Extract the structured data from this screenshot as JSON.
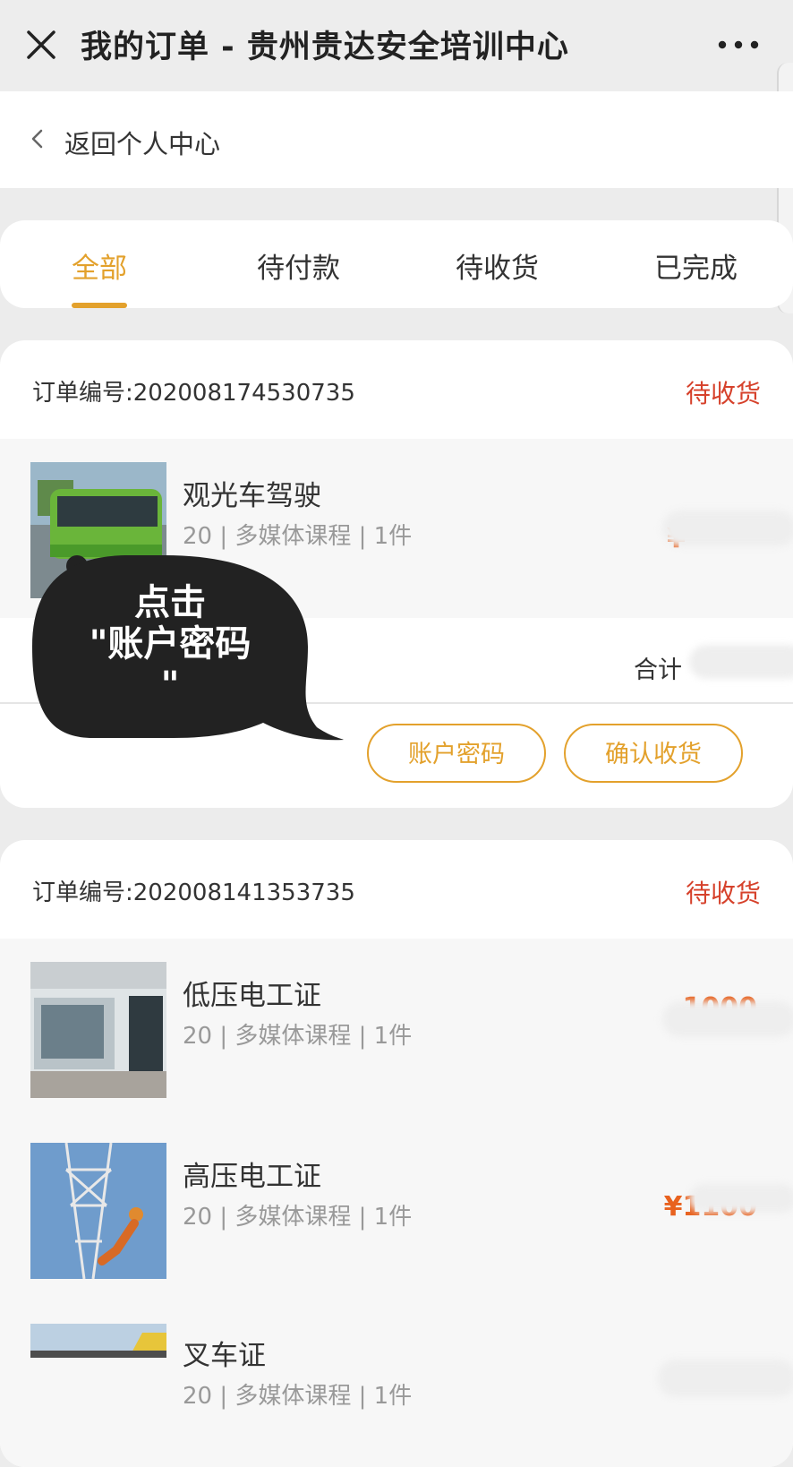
{
  "header": {
    "title": "我的订单 - 贵州贵达安全培训中心"
  },
  "back": {
    "label": "返回个人中心"
  },
  "tabs": [
    {
      "label": "全部",
      "active": true
    },
    {
      "label": "待付款"
    },
    {
      "label": "待收货"
    },
    {
      "label": "已完成"
    }
  ],
  "orders": [
    {
      "number_label": "订单编号:202008174530735",
      "status": "待收货",
      "items": [
        {
          "name": "观光车驾驶",
          "meta": "20 | 多媒体课程 | 1件",
          "price": "¥"
        }
      ],
      "total_label": "合计",
      "buttons": [
        "账户密码",
        "确认收货"
      ]
    },
    {
      "number_label": "订单编号:202008141353735",
      "status": "待收货",
      "items": [
        {
          "name": "低压电工证",
          "meta": "20 | 多媒体课程 | 1件",
          "price": "1000"
        },
        {
          "name": "高压电工证",
          "meta": "20 | 多媒体课程 | 1件",
          "price": "¥1100"
        },
        {
          "name": "叉车证",
          "meta": "20 | 多媒体课程 | 1件",
          "price": ""
        }
      ]
    }
  ],
  "bubble": {
    "text": "点击\n\"账户密码\n\""
  },
  "colors": {
    "accent": "#e3a12c",
    "status_red": "#d6412b",
    "price_orange": "#e8621f"
  },
  "icons": [
    "close-icon",
    "more-icon",
    "chevron-left-icon"
  ]
}
